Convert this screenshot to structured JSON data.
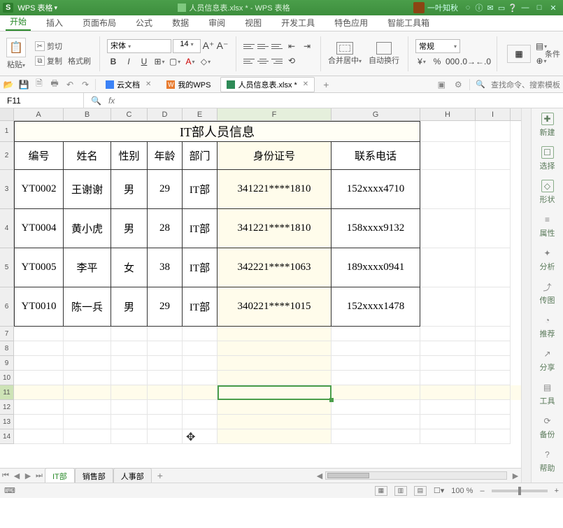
{
  "titlebar": {
    "app_logo": "S",
    "app_name": "WPS 表格",
    "doc_title": "人员信息表.xlsx * - WPS 表格",
    "user_name": "一叶知秋",
    "sysicons": [
      "◌",
      "ⓘ",
      "✉",
      "▭",
      "❔"
    ],
    "winbtns": [
      "—",
      "□",
      "✕"
    ]
  },
  "ribbon": {
    "tabs": [
      "开始",
      "插入",
      "页面布局",
      "公式",
      "数据",
      "审阅",
      "视图",
      "开发工具",
      "特色应用",
      "智能工具箱"
    ],
    "active_tab": 0,
    "paste": "粘贴",
    "cut": "剪切",
    "copy": "复制",
    "format_painter": "格式刷",
    "font_name": "宋体",
    "font_size": "14",
    "aplus": "A⁺",
    "aminus": "A⁻",
    "bold": "B",
    "italic": "I",
    "underline": "U",
    "merge": "合并居中",
    "wrap": "自动换行",
    "numfmt": "常规",
    "condfmt": "条件"
  },
  "docbar": {
    "tabs": [
      {
        "label": "云文档",
        "kind": "cloud"
      },
      {
        "label": "我的WPS",
        "kind": "wps"
      },
      {
        "label": "人员信息表.xlsx *",
        "kind": "xls",
        "active": true
      }
    ],
    "search_placeholder": "查找命令、搜索模板"
  },
  "namebox": {
    "ref": "F11",
    "fx": "fx"
  },
  "columns": [
    "A",
    "B",
    "C",
    "D",
    "E",
    "F",
    "G",
    "H",
    "I"
  ],
  "row_numbers": [
    1,
    2,
    3,
    4,
    5,
    6,
    7,
    8,
    9,
    10,
    11,
    12,
    13,
    14
  ],
  "table": {
    "title": "IT部人员信息",
    "headers": [
      "编号",
      "姓名",
      "性别",
      "年龄",
      "部门",
      "身份证号",
      "联系电话"
    ],
    "rows": [
      [
        "YT0002",
        "王谢谢",
        "男",
        "29",
        "IT部",
        "341221****1810",
        "152xxxx4710"
      ],
      [
        "YT0004",
        "黄小虎",
        "男",
        "28",
        "IT部",
        "341221****1810",
        "158xxxx9132"
      ],
      [
        "YT0005",
        "李平",
        "女",
        "38",
        "IT部",
        "342221****1063",
        "189xxxx0941"
      ],
      [
        "YT0010",
        "陈一兵",
        "男",
        "29",
        "IT部",
        "340221****1015",
        "152xxxx1478"
      ]
    ]
  },
  "sheets": {
    "tabs": [
      "IT部",
      "销售部",
      "人事部"
    ],
    "active": 0
  },
  "status": {
    "zoom": "100 %",
    "minus": "–",
    "plus": "+"
  },
  "sidepanel": [
    {
      "icon": "✚",
      "label": "新建"
    },
    {
      "icon": "☐",
      "label": "选择"
    },
    {
      "icon": "◇",
      "label": "形状"
    },
    {
      "icon": "≡",
      "label": "属性"
    },
    {
      "icon": "✦",
      "label": "分析"
    },
    {
      "icon": "⤴",
      "label": "传图"
    },
    {
      "icon": "◔",
      "label": "推荐"
    },
    {
      "icon": "↗",
      "label": "分享"
    },
    {
      "icon": "▤",
      "label": "工具"
    },
    {
      "icon": "⟳",
      "label": "备份"
    },
    {
      "icon": "?",
      "label": "帮助"
    }
  ]
}
